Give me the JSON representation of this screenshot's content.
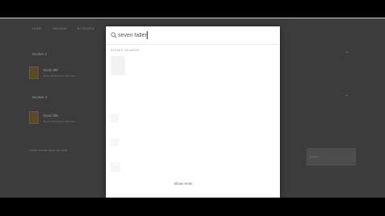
{
  "background_page": {
    "nav_items": [
      "HOME",
      "BROWSE",
      "MY BOOKS"
    ],
    "sections": [
      {
        "heading": "Section 1",
        "book_title": "Book title",
        "book_subtitle": "Book description text here"
      },
      {
        "heading": "Section 2",
        "book_title": "Book title",
        "book_subtitle": "Book description text here"
      }
    ],
    "footer_text": "Lorem ipsum dolor sit amet",
    "action_button_label": "Action"
  },
  "search": {
    "query": "seven faller",
    "section_label": "BOOKS SEARCH",
    "show_more_label": "Show more"
  },
  "colors": {
    "overlay": "#3c3c3c",
    "modal": "#ffffff",
    "bar": "#000000"
  }
}
